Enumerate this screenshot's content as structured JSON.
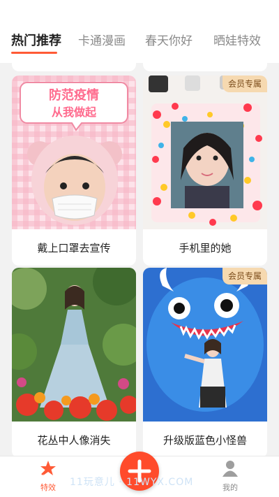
{
  "tabs": [
    {
      "label": "热门推荐"
    },
    {
      "label": "卡通漫画"
    },
    {
      "label": "春天你好"
    },
    {
      "label": "晒娃特效"
    }
  ],
  "cards": [
    {
      "label": "戴上口罩去宣传",
      "poster_title_1": "防范疫情",
      "poster_title_2": "从我做起",
      "badge": ""
    },
    {
      "label": "手机里的她",
      "badge": "会员专属"
    },
    {
      "label": "花丛中人像消失",
      "badge": ""
    },
    {
      "label": "升级版蓝色小怪兽",
      "badge": "会员专属"
    }
  ],
  "bottom_nav": {
    "left_label": "特效",
    "right_label": "我的",
    "center_icon": "plus-icon"
  },
  "watermark": "11玩意儿 · 11WYX.COM",
  "colors": {
    "accent": "#ff5a36",
    "fab": "#ff4b2b",
    "vip_badge_bg": "#f6d9b0"
  }
}
